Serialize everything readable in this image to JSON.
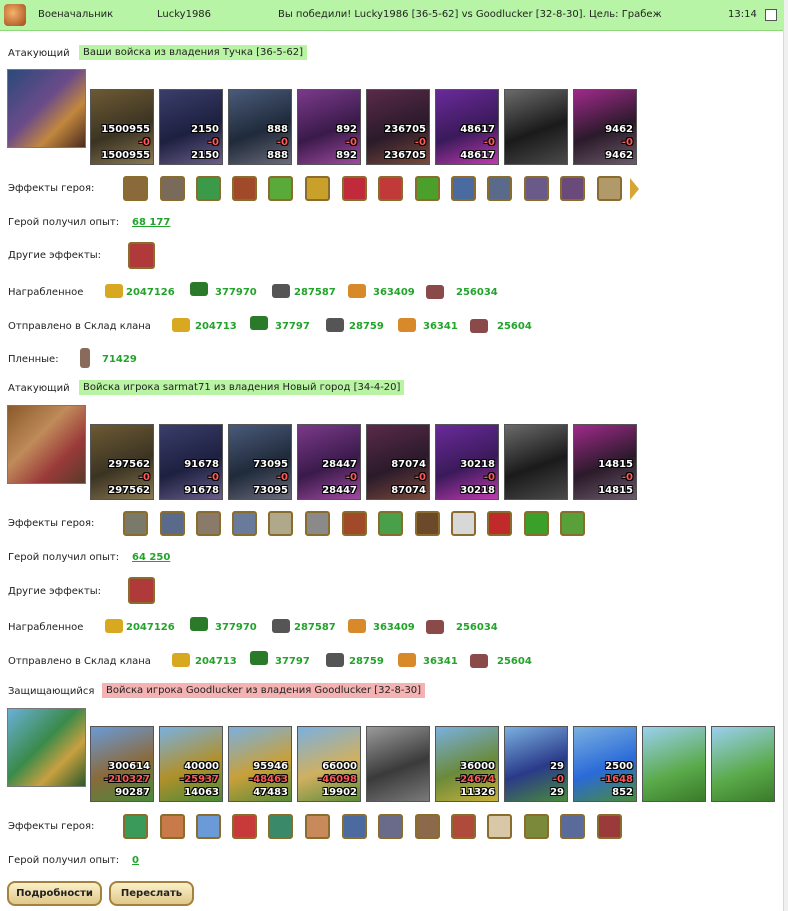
{
  "header": {
    "title": "Военачальник",
    "player": "Lucky1986",
    "message": "Вы победили! Lucky1986 [36-5-62] vs Goodlucker [32-8-30]. Цель: Грабеж",
    "time": "13:14"
  },
  "colors": {
    "header_bg": "#b8f4a6",
    "attacker_tag": "#b9f3a4",
    "defender_tag": "#f4b2b2",
    "value_green": "#22a32b",
    "loss_red": "#ff5a5a"
  },
  "labels": {
    "effects": "Эффекты героя:",
    "exp": "Герой получил опыт:",
    "other": "Другие эффекты:",
    "loot": "Награбленное",
    "sent": "Отправлено в Склад клана",
    "captives": "Пленные:"
  },
  "side1": {
    "role": "Атакующий",
    "tag": "Ваши войска из владения Тучка [36-5-62]",
    "units": [
      {
        "top": "1500955",
        "loss": "-0",
        "bottom": "1500955"
      },
      {
        "top": "2150",
        "loss": "-0",
        "bottom": "2150"
      },
      {
        "top": "888",
        "loss": "-0",
        "bottom": "888"
      },
      {
        "top": "892",
        "loss": "-0",
        "bottom": "892"
      },
      {
        "top": "236705",
        "loss": "-0",
        "bottom": "236705"
      },
      {
        "top": "48617",
        "loss": "-0",
        "bottom": "48617"
      },
      {
        "top": "",
        "loss": "",
        "bottom": ""
      },
      {
        "top": "9462",
        "loss": "-0",
        "bottom": "9462"
      }
    ],
    "exp": "68 177",
    "loot": [
      "2047126",
      "377970",
      "287587",
      "363409",
      "256034"
    ],
    "sent": [
      "204713",
      "37797",
      "28759",
      "36341",
      "25604"
    ],
    "captives": "71429"
  },
  "side2": {
    "role": "Атакующий",
    "tag": "Войска игрока sarmat71 из владения Новый город [34-4-20]",
    "units": [
      {
        "top": "297562",
        "loss": "-0",
        "bottom": "297562"
      },
      {
        "top": "91678",
        "loss": "-0",
        "bottom": "91678"
      },
      {
        "top": "73095",
        "loss": "-0",
        "bottom": "73095"
      },
      {
        "top": "28447",
        "loss": "-0",
        "bottom": "28447"
      },
      {
        "top": "87074",
        "loss": "-0",
        "bottom": "87074"
      },
      {
        "top": "30218",
        "loss": "-0",
        "bottom": "30218"
      },
      {
        "top": "",
        "loss": "",
        "bottom": ""
      },
      {
        "top": "14815",
        "loss": "-0",
        "bottom": "14815"
      }
    ],
    "exp": "64 250",
    "loot": [
      "2047126",
      "377970",
      "287587",
      "363409",
      "256034"
    ],
    "sent": [
      "204713",
      "37797",
      "28759",
      "36341",
      "25604"
    ]
  },
  "side3": {
    "role": "Защищающийся",
    "tag": "Войска игрока Goodlucker из владения Goodlucker [32-8-30]",
    "units": [
      {
        "top": "300614",
        "loss": "-210327",
        "bottom": "90287"
      },
      {
        "top": "40000",
        "loss": "-25937",
        "bottom": "14063"
      },
      {
        "top": "95946",
        "loss": "-48463",
        "bottom": "47483"
      },
      {
        "top": "66000",
        "loss": "-46098",
        "bottom": "19902"
      },
      {
        "top": "",
        "loss": "",
        "bottom": ""
      },
      {
        "top": "36000",
        "loss": "-24674",
        "bottom": "11326"
      },
      {
        "top": "29",
        "loss": "-0",
        "bottom": "29"
      },
      {
        "top": "2500",
        "loss": "-1648",
        "bottom": "852"
      },
      {
        "top": "",
        "loss": "",
        "bottom": ""
      },
      {
        "top": "",
        "loss": "",
        "bottom": ""
      }
    ],
    "exp": "0"
  },
  "buttons": {
    "details": "Подробности",
    "forward": "Переслать"
  }
}
